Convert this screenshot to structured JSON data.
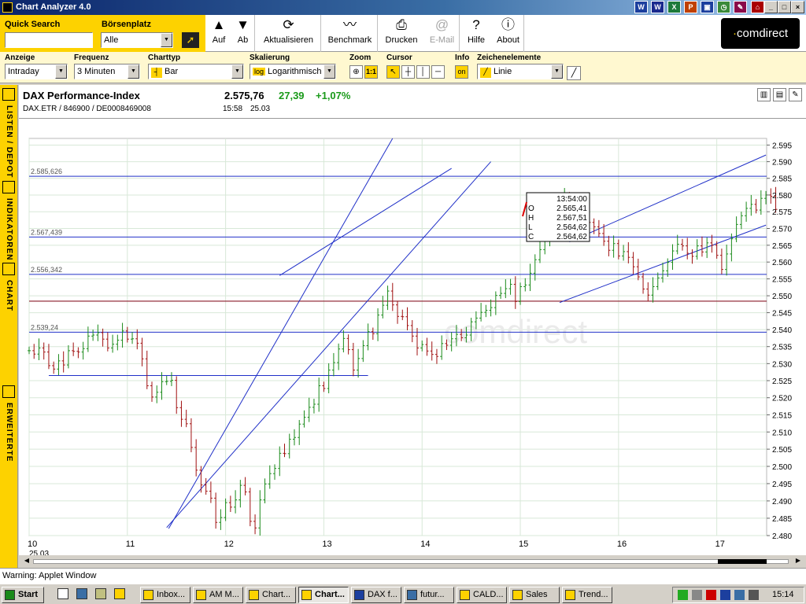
{
  "window": {
    "title": "Chart Analyzer 4.0"
  },
  "quicksearch": {
    "label": "Quick Search",
    "value": "",
    "boerse_label": "Börsenplatz",
    "boerse_value": "Alle"
  },
  "toolbar": {
    "buttons": [
      {
        "label": "Auf",
        "icon": "up-arrow-icon"
      },
      {
        "label": "Ab",
        "icon": "down-arrow-icon"
      },
      {
        "label": "Aktualisieren",
        "icon": "refresh-icon"
      },
      {
        "label": "Benchmark",
        "icon": "benchmark-icon"
      },
      {
        "label": "Drucken",
        "icon": "printer-icon"
      },
      {
        "label": "E-Mail",
        "icon": "email-icon"
      },
      {
        "label": "Hilfe",
        "icon": "help-icon"
      },
      {
        "label": "About",
        "icon": "info-icon"
      }
    ],
    "brand": "comdirect"
  },
  "controls": {
    "anzeige": {
      "label": "Anzeige",
      "value": "Intraday"
    },
    "frequenz": {
      "label": "Frequenz",
      "value": "3 Minuten"
    },
    "charttyp": {
      "label": "Charttyp",
      "value": "Bar"
    },
    "skalierung": {
      "label": "Skalierung",
      "value": "Logarithmisch",
      "badge": "log"
    },
    "zoom": {
      "label": "Zoom",
      "btn2": "1:1"
    },
    "cursor": {
      "label": "Cursor"
    },
    "info": {
      "label": "Info",
      "value": "on"
    },
    "zeichen": {
      "label": "Zeichenelemente",
      "value": "Linie"
    }
  },
  "sidebar": {
    "items": [
      "LISTEN / DEPOT",
      "INDIKATOREN",
      "CHART EINSTELLUNGEN",
      "ERWEITERTE SUCHE"
    ]
  },
  "instrument": {
    "name": "DAX Performance-Index",
    "ids": "DAX.ETR  /  846900  /  DE0008469008",
    "price": "2.575,76",
    "change": "27,39",
    "change_pct": "+1,07%",
    "time": "15:58",
    "date": "25.03"
  },
  "chart_data": {
    "type": "bar",
    "title": "DAX Performance-Index",
    "x_ticks": [
      "10",
      "11",
      "12",
      "13",
      "14",
      "15",
      "16",
      "17"
    ],
    "x_sublabel": "25.03",
    "y_ticks": [
      "2.595",
      "2.590",
      "2.585",
      "2.580",
      "2.575",
      "2.570",
      "2.565",
      "2.560",
      "2.555",
      "2.550",
      "2.545",
      "2.540",
      "2.535",
      "2.530",
      "2.525",
      "2.520",
      "2.515",
      "2.510",
      "2.505",
      "2.500",
      "2.495",
      "2.490",
      "2.485",
      "2.480"
    ],
    "ylim": [
      2480,
      2597
    ],
    "scale": "logarithmic",
    "hlines": [
      {
        "label": "2.585,626",
        "value": 2585.626
      },
      {
        "label": "2.567,439",
        "value": 2567.439
      },
      {
        "label": "2.556,342",
        "value": 2556.342
      },
      {
        "label": "2.539,24",
        "value": 2539.24
      }
    ],
    "red_line": 2548.4,
    "watermark": "comdirect",
    "tooltip": {
      "time": "13:54:00",
      "rows": [
        [
          "O",
          "2.565,41"
        ],
        [
          "H",
          "2.567,51"
        ],
        [
          "L",
          "2.564,62"
        ],
        [
          "C",
          "2.564,62"
        ]
      ]
    },
    "series": [
      [
        10.0,
        2.5338
      ],
      [
        10.05,
        2.5328
      ],
      [
        10.1,
        2.5346
      ],
      [
        10.15,
        2.5334
      ],
      [
        10.2,
        2.5294
      ],
      [
        10.25,
        2.5284
      ],
      [
        10.3,
        2.5308
      ],
      [
        10.35,
        2.5296
      ],
      [
        10.4,
        2.5338
      ],
      [
        10.45,
        2.5336
      ],
      [
        10.5,
        2.5334
      ],
      [
        10.55,
        2.5344
      ],
      [
        10.6,
        2.5381
      ],
      [
        10.65,
        2.5384
      ],
      [
        10.7,
        2.5391
      ],
      [
        10.75,
        2.5372
      ],
      [
        10.8,
        2.5346
      ],
      [
        10.85,
        2.5357
      ],
      [
        10.9,
        2.5369
      ],
      [
        10.95,
        2.5396
      ],
      [
        11.0,
        2.5372
      ],
      [
        11.05,
        2.5373
      ],
      [
        11.1,
        2.536
      ],
      [
        11.15,
        2.5314
      ],
      [
        11.2,
        2.5235
      ],
      [
        11.25,
        2.5202
      ],
      [
        11.3,
        2.5216
      ],
      [
        11.35,
        2.5247
      ],
      [
        11.4,
        2.5248
      ],
      [
        11.45,
        2.5251
      ],
      [
        11.5,
        2.5171
      ],
      [
        11.55,
        2.5137
      ],
      [
        11.6,
        2.5124
      ],
      [
        11.65,
        2.5055
      ],
      [
        11.7,
        2.4989
      ],
      [
        11.75,
        2.4946
      ],
      [
        11.8,
        2.4928
      ],
      [
        11.85,
        2.4908
      ],
      [
        11.9,
        2.4838
      ],
      [
        11.95,
        2.4852
      ],
      [
        12.0,
        2.4895
      ],
      [
        12.05,
        2.4882
      ],
      [
        12.1,
        2.4903
      ],
      [
        12.15,
        2.4945
      ],
      [
        12.2,
        2.4926
      ],
      [
        12.25,
        2.4841
      ],
      [
        12.3,
        2.4822
      ],
      [
        12.35,
        2.4903
      ],
      [
        12.4,
        2.4949
      ],
      [
        12.45,
        2.4979
      ],
      [
        12.5,
        2.4994
      ],
      [
        12.55,
        2.5038
      ],
      [
        12.6,
        2.5037
      ],
      [
        12.65,
        2.5079
      ],
      [
        12.7,
        2.5084
      ],
      [
        12.75,
        2.5123
      ],
      [
        12.8,
        2.5143
      ],
      [
        12.85,
        2.5172
      ],
      [
        12.9,
        2.5181
      ],
      [
        12.95,
        2.5235
      ],
      [
        13.0,
        2.5227
      ],
      [
        13.05,
        2.5281
      ],
      [
        13.1,
        2.5303
      ],
      [
        13.15,
        2.5343
      ],
      [
        13.2,
        2.5374
      ],
      [
        13.25,
        2.5341
      ],
      [
        13.3,
        2.5281
      ],
      [
        13.35,
        2.5315
      ],
      [
        13.4,
        2.5353
      ],
      [
        13.45,
        2.5394
      ],
      [
        13.5,
        2.5388
      ],
      [
        13.55,
        2.5443
      ],
      [
        13.6,
        2.5472
      ],
      [
        13.65,
        2.5514
      ],
      [
        13.7,
        2.5473
      ],
      [
        13.75,
        2.5439
      ],
      [
        13.8,
        2.5438
      ],
      [
        13.85,
        2.5412
      ],
      [
        13.9,
        2.5381
      ],
      [
        13.95,
        2.5346
      ],
      [
        14.0,
        2.5356
      ],
      [
        14.05,
        2.5337
      ],
      [
        14.1,
        2.5327
      ],
      [
        14.15,
        2.5321
      ],
      [
        14.2,
        2.5359
      ],
      [
        14.25,
        2.5354
      ],
      [
        14.3,
        2.5373
      ],
      [
        14.35,
        2.5386
      ],
      [
        14.4,
        2.5376
      ],
      [
        14.45,
        2.5384
      ],
      [
        14.5,
        2.5423
      ],
      [
        14.55,
        2.5434
      ],
      [
        14.6,
        2.5451
      ],
      [
        14.65,
        2.5457
      ],
      [
        14.7,
        2.5465
      ],
      [
        14.75,
        2.5501
      ],
      [
        14.8,
        2.5507
      ],
      [
        14.85,
        2.5521
      ],
      [
        14.9,
        2.5534
      ],
      [
        14.95,
        2.5483
      ],
      [
        15.0,
        2.5527
      ],
      [
        15.05,
        2.5532
      ],
      [
        15.1,
        2.5567
      ],
      [
        15.15,
        2.5607
      ],
      [
        15.2,
        2.5637
      ],
      [
        15.25,
        2.5665
      ],
      [
        15.3,
        2.5694
      ],
      [
        15.35,
        2.5727
      ],
      [
        15.4,
        2.5761
      ],
      [
        15.45,
        2.5797
      ],
      [
        15.5,
        2.578
      ],
      [
        15.55,
        2.5759
      ],
      [
        15.6,
        2.5764
      ],
      [
        15.65,
        2.5756
      ],
      [
        15.7,
        2.5718
      ],
      [
        15.75,
        2.5705
      ],
      [
        15.8,
        2.5685
      ],
      [
        15.85,
        2.5662
      ],
      [
        15.9,
        2.5635
      ],
      [
        15.95,
        2.5655
      ],
      [
        16.0,
        2.5618
      ],
      [
        16.05,
        2.5631
      ],
      [
        16.1,
        2.5614
      ],
      [
        16.15,
        2.5586
      ],
      [
        16.2,
        2.5556
      ],
      [
        16.25,
        2.552
      ],
      [
        16.3,
        2.5502
      ],
      [
        16.35,
        2.5527
      ],
      [
        16.4,
        2.5553
      ],
      [
        16.45,
        2.5574
      ],
      [
        16.5,
        2.5599
      ],
      [
        16.55,
        2.5633
      ],
      [
        16.6,
        2.5653
      ],
      [
        16.65,
        2.5648
      ],
      [
        16.7,
        2.5626
      ],
      [
        16.75,
        2.5617
      ],
      [
        16.8,
        2.5648
      ],
      [
        16.85,
        2.563
      ],
      [
        16.9,
        2.5657
      ],
      [
        16.95,
        2.565
      ],
      [
        17.0,
        2.562
      ],
      [
        17.05,
        2.5578
      ],
      [
        17.1,
        2.5624
      ],
      [
        17.15,
        2.5669
      ],
      [
        17.2,
        2.5712
      ],
      [
        17.25,
        2.5738
      ],
      [
        17.3,
        2.576
      ],
      [
        17.35,
        2.5772
      ],
      [
        17.4,
        2.5755
      ],
      [
        17.45,
        2.579
      ],
      [
        17.5,
        2.58
      ],
      [
        17.55,
        2.5796
      ],
      [
        17.6,
        2.5757
      ]
    ]
  },
  "status": {
    "text": "Warning: Applet Window"
  },
  "taskbar": {
    "start": "Start",
    "tasks": [
      "Inbox...",
      "AM M...",
      "Chart...",
      "Chart...",
      "DAX f...",
      "futur...",
      "CALD...",
      "Sales",
      "Trend..."
    ],
    "active_index": 3,
    "clock": "15:14"
  }
}
